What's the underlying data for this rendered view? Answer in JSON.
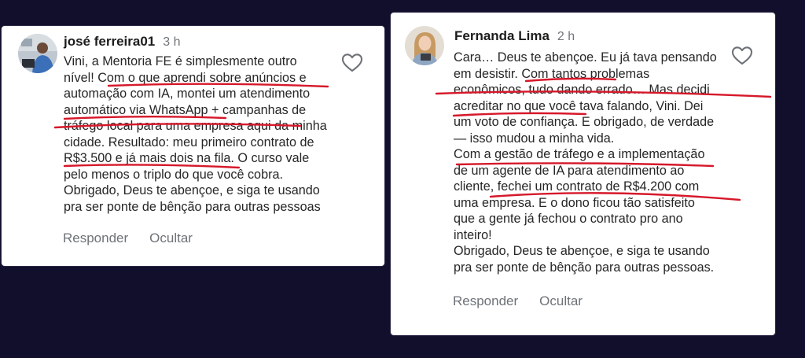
{
  "comments": [
    {
      "author": "josé ferreira01",
      "time": "3 h",
      "lines": [
        "Vini, a Mentoria FE é simplesmente outro",
        "nível! Com o que aprendi sobre anúncios e",
        "automação com IA, montei um atendimento",
        "automático via WhatsApp + campanhas de",
        "tráfego local para uma empresa aqui da minha",
        "cidade. Resultado: meu primeiro contrato de",
        "R$3.500 e já mais dois na fila. O curso vale",
        "pelo menos o triplo do que você cobra.",
        "Obrigado, Deus te abençoe, e siga te usando",
        "pra ser ponte de bênção para outras pessoas"
      ],
      "actions": {
        "reply": "Responder",
        "hide": "Ocultar"
      },
      "icons": {
        "like": "heart-outline-icon"
      }
    },
    {
      "author": "Fernanda Lima",
      "time": "2 h",
      "lines": [
        "Cara… Deus te abençoe. Eu já tava pensando",
        "em desistir. Com tantos problemas",
        "econômicos, tudo dando errado… Mas decidi",
        "acreditar no que você tava falando, Vini. Dei",
        "um voto de confiança. E obrigado, de verdade",
        "— isso mudou a minha vida.",
        " Com a gestão de tráfego e a implementação",
        "de um agente de IA para atendimento ao",
        "cliente, fechei um contrato de R$4.200 com",
        "uma empresa. E o dono ficou tão satisfeito",
        "que a gente já fechou o contrato pro ano",
        "inteiro!",
        "Obrigado, Deus te abençoe, e siga te usando",
        "pra ser ponte de bênção para outras pessoas."
      ],
      "actions": {
        "reply": "Responder",
        "hide": "Ocultar"
      },
      "icons": {
        "like": "heart-outline-icon"
      }
    }
  ],
  "colors": {
    "background": "#120f2c",
    "card": "#ffffff",
    "underline": "#d6182a",
    "text": "#262626",
    "muted": "#6e7277"
  }
}
